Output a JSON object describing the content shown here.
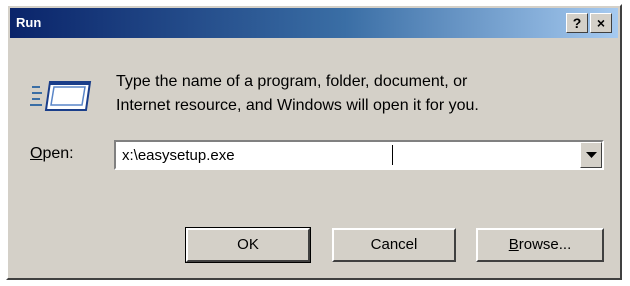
{
  "window": {
    "title": "Run",
    "help_label": "?",
    "close_label": "×"
  },
  "description": {
    "line1": "Type the name of a program, folder, document, or",
    "line2": "Internet resource, and Windows will open it for you."
  },
  "open_field": {
    "label_accel": "O",
    "label_rest": "pen:",
    "value": "x:\\easysetup.exe"
  },
  "buttons": {
    "ok_label": "OK",
    "cancel_label": "Cancel",
    "browse_accel": "B",
    "browse_rest": "rowse..."
  },
  "icons": {
    "run": "run-icon",
    "dropdown": "chevron-down-icon"
  },
  "colors": {
    "title_gradient_start": "#0a246a",
    "title_gradient_end": "#a6caf0",
    "dialog_face": "#d4d0c8"
  }
}
